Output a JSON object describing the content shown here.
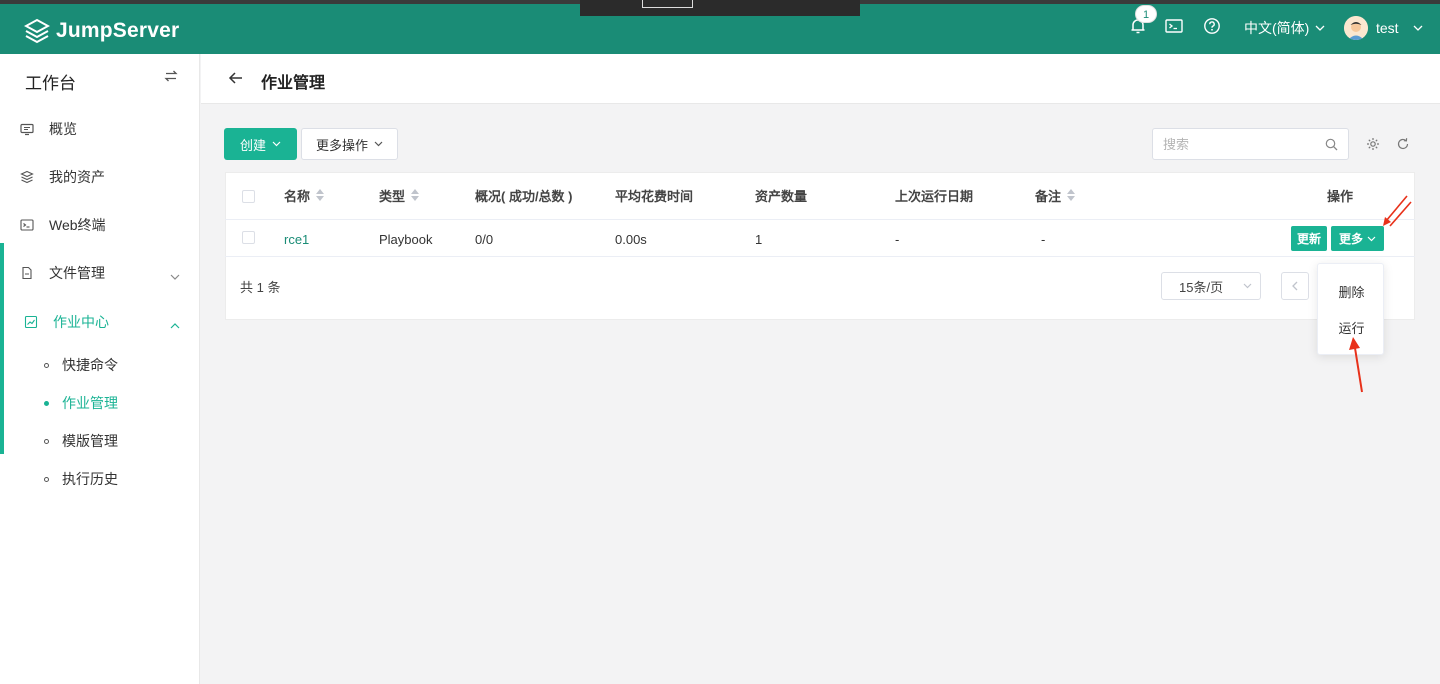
{
  "header": {
    "brand": "JumpServer",
    "notification_count": "1",
    "language": "中文(简体)",
    "username": "test",
    "icons": [
      "bell-icon",
      "terminal-icon",
      "help-icon"
    ]
  },
  "sidebar": {
    "title": "工作台",
    "items": [
      {
        "label": "概览",
        "icon": "overview-icon"
      },
      {
        "label": "我的资产",
        "icon": "assets-icon"
      },
      {
        "label": "Web终端",
        "icon": "terminal-icon"
      },
      {
        "label": "文件管理",
        "icon": "file-icon"
      },
      {
        "label": "作业中心",
        "icon": "job-icon"
      }
    ],
    "sub_items": [
      {
        "label": "快捷命令",
        "active": false
      },
      {
        "label": "作业管理",
        "active": true
      },
      {
        "label": "模版管理",
        "active": false
      },
      {
        "label": "执行历史",
        "active": false
      }
    ]
  },
  "page": {
    "title": "作业管理"
  },
  "toolbar": {
    "create_label": "创建",
    "more_ops_label": "更多操作",
    "search_placeholder": "搜索"
  },
  "table": {
    "columns": [
      "名称",
      "类型",
      "概况( 成功/总数 )",
      "平均花费时间",
      "资产数量",
      "上次运行日期",
      "备注",
      "操作"
    ],
    "rows": [
      {
        "name": "rce1",
        "type": "Playbook",
        "summary": "0/0",
        "avg_time": "0.00s",
        "asset_count": "1",
        "last_run": "-",
        "comment": "-",
        "update_label": "更新",
        "more_label": "更多"
      }
    ]
  },
  "pagination": {
    "total": "共 1 条",
    "page_size": "15条/页"
  },
  "dropdown": {
    "items": [
      "删除",
      "运行"
    ]
  },
  "colors": {
    "header_bg": "#1a8c76",
    "primary": "#1ab394",
    "annotation": "#e8311a"
  }
}
